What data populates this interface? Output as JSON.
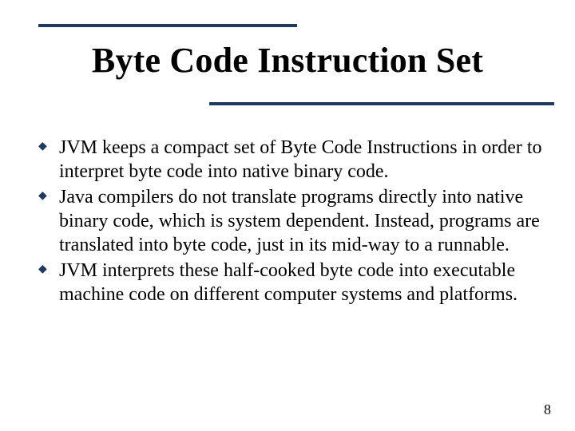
{
  "title": "Byte Code Instruction Set",
  "bullets": [
    "JVM keeps a compact set of Byte Code Instructions in order to interpret byte code into native binary code.",
    "Java compilers do not translate programs directly into native binary code, which is system dependent. Instead, programs are translated into byte code, just in its mid-way to a runnable.",
    "JVM interprets these half-cooked byte code into executable machine code on different computer systems and platforms."
  ],
  "bullet_glyph": "◆",
  "page_number": "8",
  "accent_color": "#1f3a5f"
}
